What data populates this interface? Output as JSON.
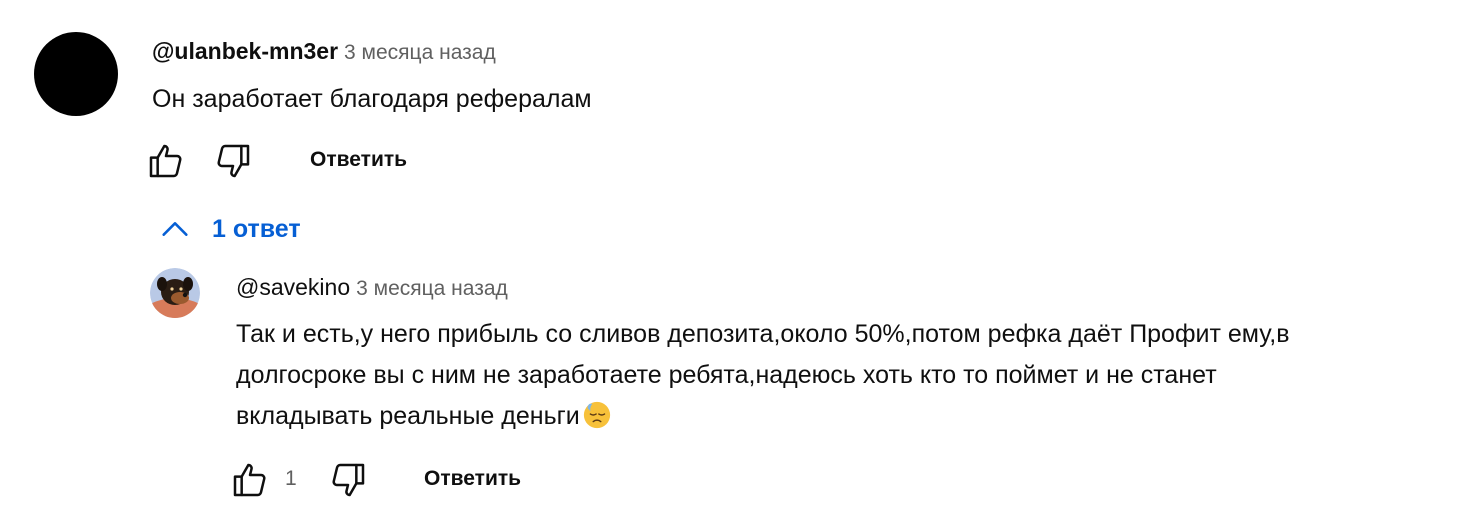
{
  "comment": {
    "author": "@ulanbek-mn3er",
    "timestamp": "3 месяца назад",
    "text": "Он заработает благодаря рефералам",
    "reply_label": "Ответить",
    "avatar_color": "#000000"
  },
  "replies_toggle": {
    "label": "1 ответ",
    "icon": "chevron-up-icon",
    "color": "#065fd4"
  },
  "reply": {
    "author": "@savekino",
    "timestamp": "3 месяца назад",
    "text_lines": [
      "Так и есть,у него прибыль со сливов депозита,около 50%,потом рефка даёт Профит ему,в",
      "долгосроке вы с ним не заработаете ребята,надеюсь хоть кто то поймет и не станет",
      "вкладывать реальные деньги"
    ],
    "emoji": "downcast-face-with-sweat-icon",
    "like_count": "1",
    "reply_label": "Ответить",
    "avatar_icon": "rottweiler-avatar-icon"
  },
  "icons": {
    "like": "thumbs-up-icon",
    "dislike": "thumbs-down-icon"
  }
}
